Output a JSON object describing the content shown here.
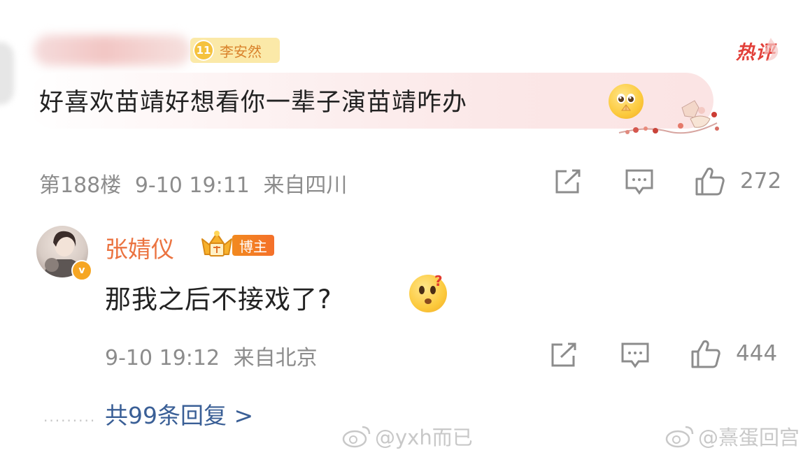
{
  "comment": {
    "fan_badge": {
      "level": "11",
      "name": "李安然"
    },
    "hot_label": "热评",
    "text": "好喜欢苗靖好想看你一辈子演苗靖咋办",
    "emoji": "pleading-face-icon",
    "floor": "第188楼",
    "time": "9-10 19:11",
    "location": "来自四川",
    "likes": "272"
  },
  "reply": {
    "author": "张婧仪",
    "role_tag": "博主",
    "text": "那我之后不接戏了?",
    "emoji": "thinking-face-icon",
    "time": "9-10 19:12",
    "location": "来自北京",
    "likes": "444"
  },
  "more_replies": "共99条回复 >",
  "watermarks": [
    "@yxh而已",
    "@熹蛋回宫"
  ],
  "colors": {
    "author": "#eb7340",
    "link": "#3a5f96",
    "meta": "#8c8c8c",
    "hot": "#e2403a"
  }
}
